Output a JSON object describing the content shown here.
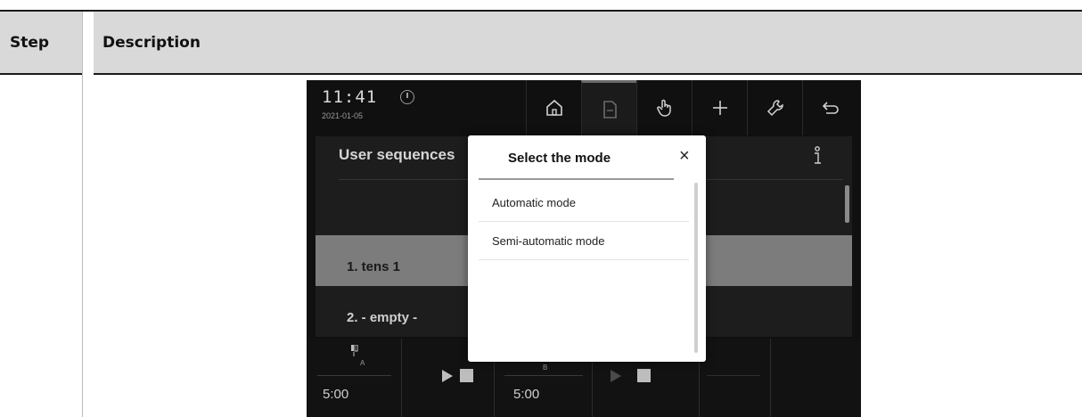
{
  "table": {
    "col_step": "Step",
    "col_description": "Description"
  },
  "device": {
    "clock": "11:41",
    "date": "2021-01-05",
    "nav_icons": [
      "home-icon",
      "document-icon",
      "hand-icon",
      "plus-icon",
      "wrench-icon",
      "back-icon"
    ],
    "panel_title": "User sequences",
    "rows": [
      "1. tens 1",
      "2. - empty -"
    ],
    "bottom": {
      "a_label": "A",
      "a_time": "5:00",
      "b_label": "B",
      "b_time": "5:00"
    }
  },
  "modal": {
    "title": "Select the mode",
    "close": "×",
    "options": [
      "Automatic mode",
      "Semi-automatic mode"
    ]
  },
  "colors": {
    "header_bg": "#d9d9d9",
    "device_bg": "#101010",
    "selected_row": "#7c7c7c",
    "modal_bg": "#ffffff"
  }
}
